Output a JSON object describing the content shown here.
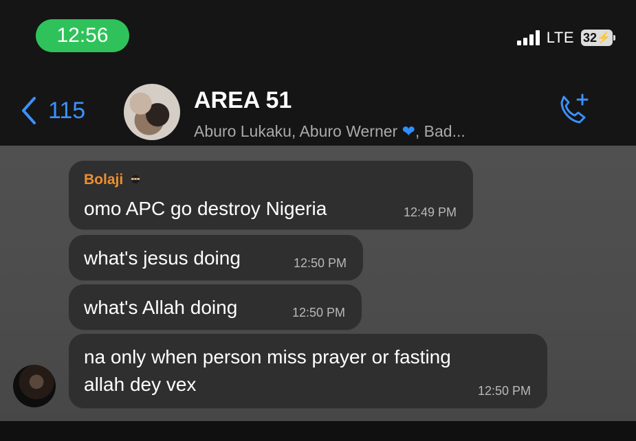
{
  "status_bar": {
    "time": "12:56",
    "network": "LTE",
    "battery": "32"
  },
  "header": {
    "back_count": "115",
    "title": "AREA 51",
    "members": "Aburo Lukaku, Aburo Werner ",
    "members_after_icon": ", Bad..."
  },
  "messages": [
    {
      "sender": "Bolaji",
      "text": "omo APC go destroy Nigeria",
      "time": "12:49 PM"
    },
    {
      "text": "what's jesus doing",
      "time": "12:50 PM"
    },
    {
      "text": "what's Allah doing",
      "time": "12:50 PM"
    },
    {
      "text_line1": "na only when person miss prayer or fasting",
      "text_line2": "allah dey vex",
      "time": "12:50 PM"
    }
  ],
  "icons": {
    "back": "chevron-left-icon",
    "call": "add-call-icon",
    "signal": "signal-bars-icon",
    "battery": "battery-icon",
    "heart": "blue-heart-icon",
    "sender_emoji": "ninja-icon"
  },
  "colors": {
    "accent_blue": "#3b91ff",
    "time_pill_green": "#2fc25a",
    "sender_orange": "#ef8f2d",
    "bubble": "#2f2f2f"
  }
}
